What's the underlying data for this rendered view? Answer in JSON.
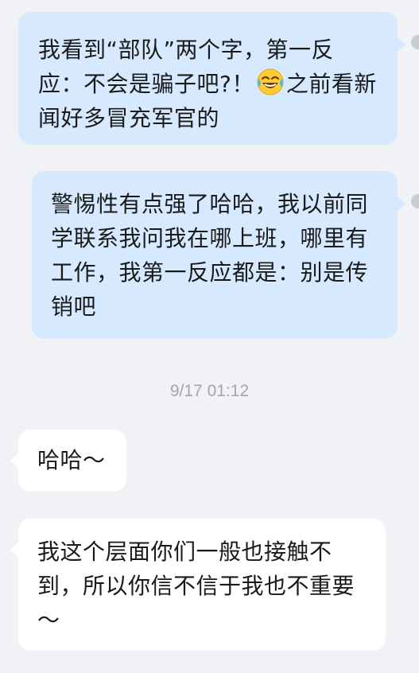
{
  "messages": [
    {
      "direction": "outgoing",
      "text_before_emoji": "我看到“部队”两个字，第一反应：不会是骗子吧?！",
      "emoji": "face-with-tears-of-joy",
      "text_after_emoji": "之前看新闻好多冒充军官的"
    },
    {
      "direction": "outgoing",
      "text": "警惕性有点强了哈哈，我以前同学联系我问我在哪上班，哪里有工作，我第一反应都是：别是传销吧"
    },
    {
      "direction": "incoming",
      "text": "哈哈～"
    },
    {
      "direction": "incoming",
      "text": "我这个层面你们一般也接触不到，所以你信不信于我也不重要～"
    }
  ],
  "timestamp": "9/17 01:12",
  "colors": {
    "background": "#f0f2f5",
    "outgoing_bubble": "#d6e9ff",
    "incoming_bubble": "#ffffff",
    "text": "#1a1a1a",
    "timestamp": "#a3a6ab"
  }
}
